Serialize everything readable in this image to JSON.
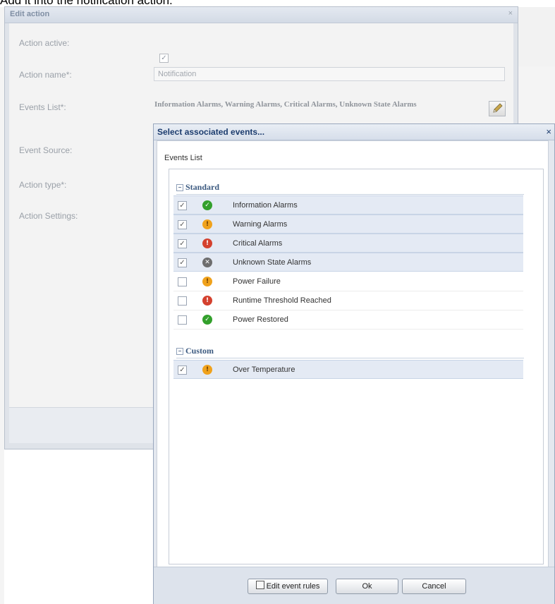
{
  "caption": "Add it into the notification action.",
  "edit_window": {
    "title": "Edit action",
    "close_glyph": "×",
    "fields": {
      "action_active_label": "Action active:",
      "action_active_checked": true,
      "action_name_label": "Action name*:",
      "action_name_value": "Notification",
      "events_list_label": "Events List*:",
      "events_list_value": "Information Alarms, Warning Alarms, Critical Alarms, Unknown State Alarms",
      "event_source_label": "Event Source:",
      "action_type_label": "Action type*:",
      "action_settings_label": "Action Settings:"
    },
    "edit_events_icon": "pencil-icon"
  },
  "dialog": {
    "title": "Select associated events...",
    "close_glyph": "×",
    "list_label": "Events List",
    "groups": [
      {
        "name": "Standard",
        "toggle": "−",
        "items": [
          {
            "label": "Information Alarms",
            "checked": true,
            "status": "information",
            "icon": "green-check-icon",
            "glyph": "✓"
          },
          {
            "label": "Warning Alarms",
            "checked": true,
            "status": "warning",
            "icon": "warning-icon",
            "glyph": "!"
          },
          {
            "label": "Critical Alarms",
            "checked": true,
            "status": "critical",
            "icon": "critical-icon",
            "glyph": "!"
          },
          {
            "label": "Unknown State Alarms",
            "checked": true,
            "status": "unknown",
            "icon": "unknown-icon",
            "glyph": "✕"
          },
          {
            "label": "Power Failure",
            "checked": false,
            "status": "warning",
            "icon": "warning-icon",
            "glyph": "!"
          },
          {
            "label": "Runtime Threshold Reached",
            "checked": false,
            "status": "critical",
            "icon": "critical-icon",
            "glyph": "!"
          },
          {
            "label": "Power Restored",
            "checked": false,
            "status": "information",
            "icon": "green-check-icon",
            "glyph": "✓"
          }
        ]
      },
      {
        "name": "Custom",
        "toggle": "−",
        "items": [
          {
            "label": "Over Temperature",
            "checked": true,
            "status": "warning",
            "icon": "warning-icon",
            "glyph": "!"
          }
        ]
      }
    ],
    "buttons": {
      "edit_event_rules": "Edit event rules",
      "ok": "Ok",
      "cancel": "Cancel"
    }
  },
  "colors": {
    "information": "#33a02c",
    "warning": "#f0a21c",
    "critical": "#d4412e",
    "unknown": "#6e6e6e",
    "dialog_title": "#1c3c6e"
  }
}
